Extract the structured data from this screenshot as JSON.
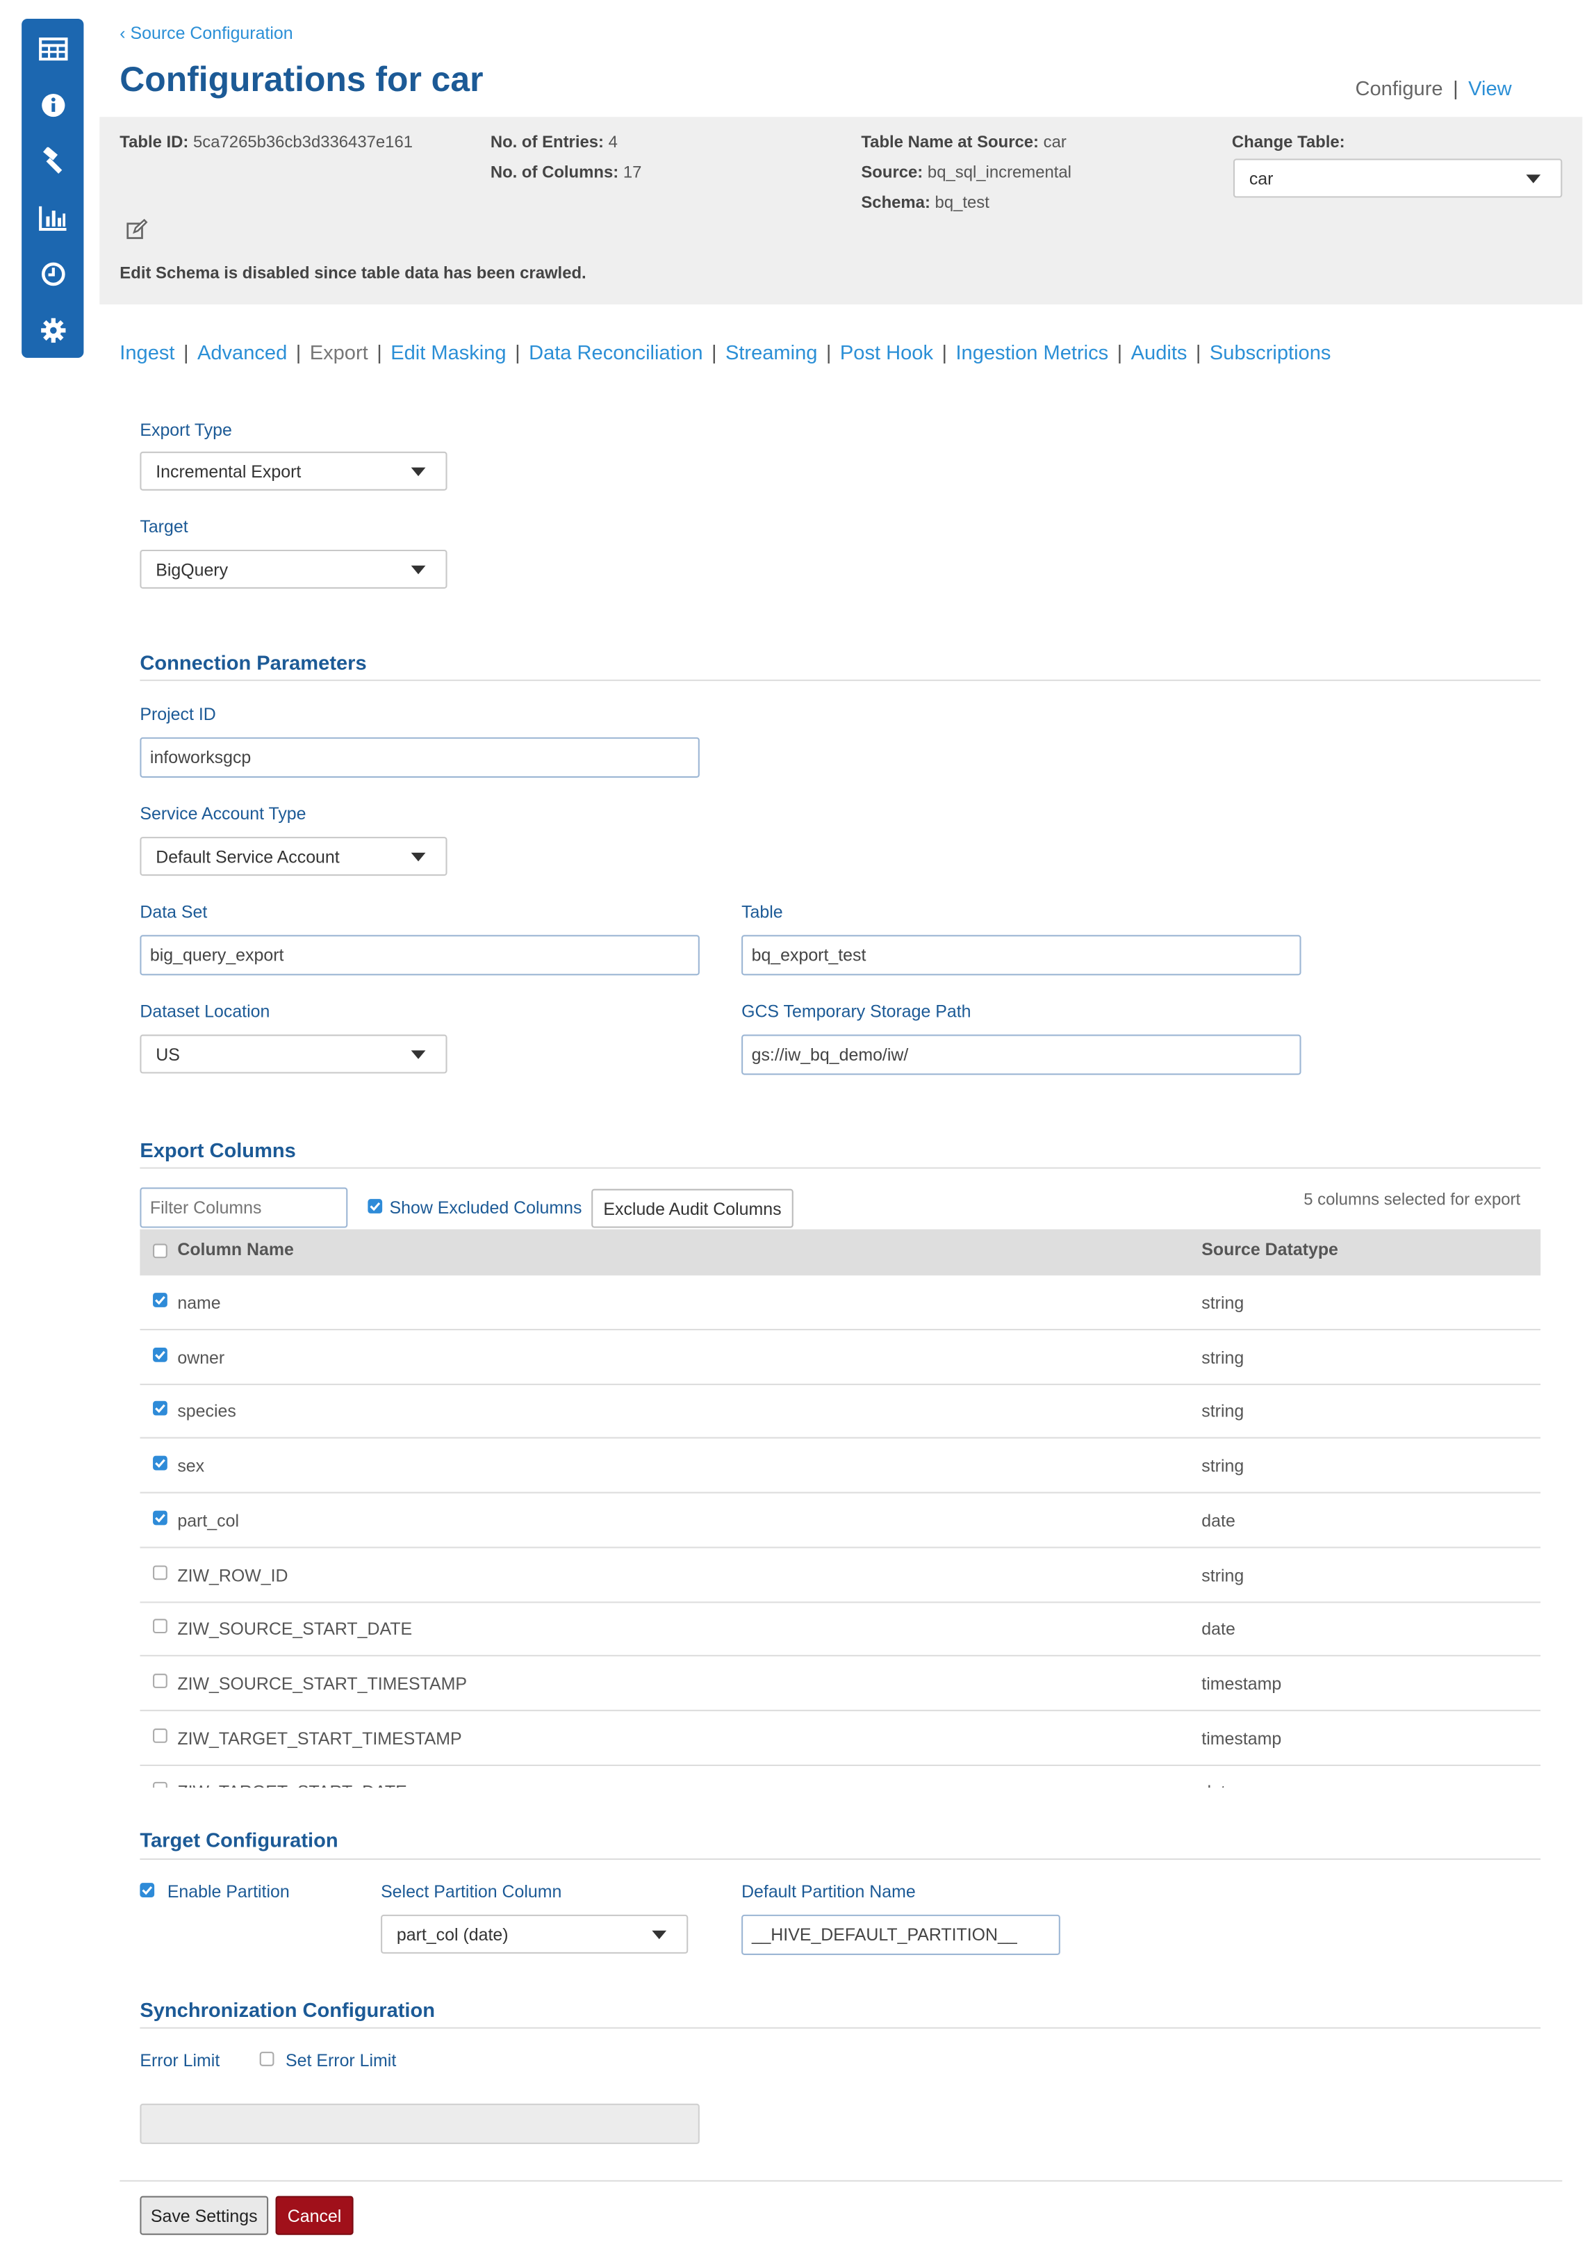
{
  "header": {
    "back_link": "Source Configuration",
    "title": "Configurations for car",
    "configure_label": "Configure",
    "view_label": "View"
  },
  "info": {
    "table_id_label": "Table ID:",
    "table_id_value": "5ca7265b36cb3d336437e161",
    "entries_label": "No. of Entries:",
    "entries_value": "4",
    "columns_label": "No. of Columns:",
    "columns_value": "17",
    "table_name_label": "Table Name at Source:",
    "table_name_value": "car",
    "source_label": "Source:",
    "source_value": "bq_sql_incremental",
    "schema_label": "Schema:",
    "schema_value": "bq_test",
    "change_table_label": "Change Table:",
    "change_table_value": "car",
    "edit_schema_note": "Edit Schema is disabled since table data has been crawled."
  },
  "tabs": [
    "Ingest",
    "Advanced",
    "Export",
    "Edit Masking",
    "Data Reconciliation",
    "Streaming",
    "Post Hook",
    "Ingestion Metrics",
    "Audits",
    "Subscriptions"
  ],
  "active_tab": "Export",
  "export": {
    "export_type_label": "Export Type",
    "export_type_value": "Incremental Export",
    "target_label": "Target",
    "target_value": "BigQuery"
  },
  "connection": {
    "title": "Connection Parameters",
    "project_id_label": "Project ID",
    "project_id_value": "infoworksgcp",
    "service_account_label": "Service Account Type",
    "service_account_value": "Default Service Account",
    "dataset_label": "Data Set",
    "dataset_value": "big_query_export",
    "table_label": "Table",
    "table_value": "bq_export_test",
    "dataset_location_label": "Dataset Location",
    "dataset_location_value": "US",
    "gcs_path_label": "GCS Temporary Storage Path",
    "gcs_path_value": "gs://iw_bq_demo/iw/"
  },
  "export_columns": {
    "title": "Export Columns",
    "filter_placeholder": "Filter Columns",
    "show_excluded_label": "Show Excluded Columns",
    "show_excluded_checked": true,
    "exclude_audit_label": "Exclude Audit Columns",
    "selected_count_text": "5 columns selected for export",
    "col_name_header": "Column Name",
    "col_type_header": "Source Datatype",
    "rows": [
      {
        "name": "name",
        "type": "string",
        "checked": true
      },
      {
        "name": "owner",
        "type": "string",
        "checked": true
      },
      {
        "name": "species",
        "type": "string",
        "checked": true
      },
      {
        "name": "sex",
        "type": "string",
        "checked": true
      },
      {
        "name": "part_col",
        "type": "date",
        "checked": true
      },
      {
        "name": "ZIW_ROW_ID",
        "type": "string",
        "checked": false
      },
      {
        "name": "ZIW_SOURCE_START_DATE",
        "type": "date",
        "checked": false
      },
      {
        "name": "ZIW_SOURCE_START_TIMESTAMP",
        "type": "timestamp",
        "checked": false
      },
      {
        "name": "ZIW_TARGET_START_TIMESTAMP",
        "type": "timestamp",
        "checked": false
      },
      {
        "name": "ZIW_TARGET_START_DATE",
        "type": "date",
        "checked": false
      }
    ]
  },
  "target_config": {
    "title": "Target Configuration",
    "enable_partition_label": "Enable Partition",
    "enable_partition_checked": true,
    "partition_column_label": "Select Partition Column",
    "partition_column_value": "part_col (date)",
    "default_partition_label": "Default Partition Name",
    "default_partition_value": "__HIVE_DEFAULT_PARTITION__"
  },
  "sync_config": {
    "title": "Synchronization Configuration",
    "error_limit_label": "Error Limit",
    "set_error_limit_label": "Set Error Limit",
    "set_error_limit_checked": false
  },
  "footer": {
    "save_label": "Save Settings",
    "cancel_label": "Cancel"
  },
  "colors": {
    "sidebar": "#1c67b0",
    "link": "#2b8fd6",
    "heading": "#1c5a96",
    "cancel": "#a0101a"
  },
  "sidebar_icons": [
    "table-icon",
    "info-icon",
    "hammer-icon",
    "bar-chart-icon",
    "clock-icon",
    "gear-icon"
  ]
}
